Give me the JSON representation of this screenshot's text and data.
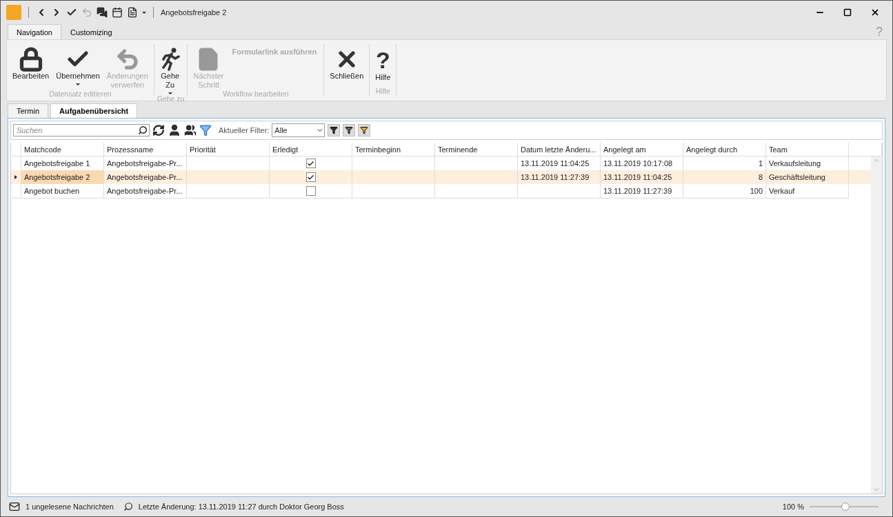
{
  "window": {
    "title": "Angebotsfreigabe 2"
  },
  "ribbon_tabs": [
    {
      "label": "Navigation",
      "selected": true
    },
    {
      "label": "Customizing",
      "selected": false
    }
  ],
  "help_glyph": "?",
  "ribbon_groups": [
    {
      "label": "Datensatz editieren",
      "buttons": [
        {
          "kind": "lock",
          "lines": [
            "Bearbeiten"
          ],
          "disabled": false,
          "dropdown": false
        },
        {
          "kind": "check",
          "lines": [
            "Übernehmen"
          ],
          "disabled": false,
          "dropdown": true
        },
        {
          "kind": "undo",
          "lines": [
            "Änderungen",
            "verwerfen"
          ],
          "disabled": true,
          "dropdown": false
        }
      ]
    },
    {
      "label": "Gehe zu",
      "buttons": [
        {
          "kind": "run",
          "lines": [
            "Gehe",
            "Zu"
          ],
          "disabled": false,
          "dropdown": true
        }
      ]
    },
    {
      "label": "Workflow bearbeiten",
      "buttons": [
        {
          "kind": "doc",
          "lines": [
            "Nächster",
            "Schritt"
          ],
          "disabled": true,
          "dropdown": false
        }
      ],
      "link": {
        "label": "Formularlink ausführen",
        "disabled": true
      }
    },
    {
      "buttons": [
        {
          "kind": "close",
          "lines": [
            "Schließen"
          ],
          "disabled": false,
          "dropdown": false
        }
      ]
    },
    {
      "label": "Hilfe",
      "buttons": [
        {
          "kind": "help",
          "glyph": "?",
          "lines": [
            "Hilfe"
          ],
          "disabled": false,
          "dropdown": false
        }
      ]
    }
  ],
  "doc_tabs": [
    {
      "label": "Termin",
      "selected": false
    },
    {
      "label": "Aufgabenübersicht",
      "selected": true
    }
  ],
  "toolbar": {
    "search_placeholder": "Suchen",
    "filter_label": "Aktueller Filter:",
    "filter_value": "Alle"
  },
  "table": {
    "columns": [
      "Matchcode",
      "Prozessname",
      "Priorität",
      "Erledigt",
      "Terminbeginn",
      "Terminende",
      "Datum letzte Änderu...",
      "Angelegt am",
      "Angelegt durch",
      "Team"
    ],
    "rows": [
      {
        "selected": false,
        "cells": [
          "Angebotsfreigabe 1",
          "Angebotsfreigabe-Pr...",
          "",
          null,
          "",
          "",
          "13.11.2019 11:04:25",
          "13.11.2019 10:17:08",
          "1",
          "Verkaufsleitung"
        ],
        "checked": true
      },
      {
        "selected": true,
        "cells": [
          "Angebotsfreigabe 2",
          "Angebotsfreigabe-Pr...",
          "",
          null,
          "",
          "",
          "13.11.2019 11:27:39",
          "13.11.2019 11:04:25",
          "8",
          "Geschäftsleitung"
        ],
        "checked": true
      },
      {
        "selected": false,
        "cells": [
          "Angebot buchen",
          "Angebotsfreigabe-Pr...",
          "",
          null,
          "",
          "",
          "",
          "13.11.2019 11:27:39",
          "100",
          "Verkauf"
        ],
        "checked": false
      }
    ]
  },
  "status_bar": {
    "messages": "1 ungelesene Nachrichten",
    "last_change": "Letzte Änderung: 13.11.2019 11:27 durch Doktor Georg Boss",
    "zoom": "100 %",
    "level": 0.52
  }
}
